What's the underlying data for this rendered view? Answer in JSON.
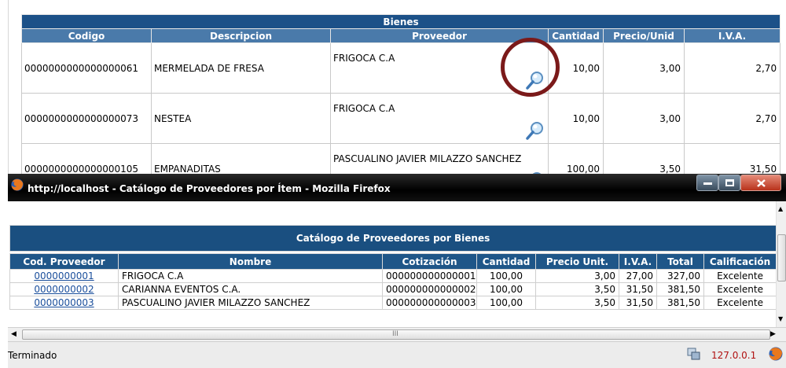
{
  "background_page": {
    "table_title": "Bienes",
    "headers": [
      "Codigo",
      "Descripcion",
      "Proveedor",
      "Cantidad",
      "Precio/Unid",
      "I.V.A."
    ],
    "rows": [
      {
        "codigo": "0000000000000000061",
        "descripcion": "MERMELADA DE FRESA",
        "proveedor": "FRIGOCA C.A",
        "cantidad": "10,00",
        "precio": "3,00",
        "iva": "2,70"
      },
      {
        "codigo": "0000000000000000073",
        "descripcion": "NESTEA",
        "proveedor": "FRIGOCA C.A",
        "cantidad": "10,00",
        "precio": "3,00",
        "iva": "2,70"
      },
      {
        "codigo": "0000000000000000105",
        "descripcion": "EMPANADITAS",
        "proveedor": "PASCUALINO JAVIER MILAZZO SANCHEZ",
        "cantidad": "100,00",
        "precio": "3,50",
        "iva": "31,50"
      }
    ],
    "row_icon": "magnifier-icon",
    "highlight_color": "#7b1a1a"
  },
  "popup": {
    "title": "http://localhost - Catálogo de Proveedores por Ítem - Mozilla Firefox",
    "table_title": "Catálogo de Proveedores por Bienes",
    "headers": [
      "Cod. Proveedor",
      "Nombre",
      "Cotización",
      "Cantidad",
      "Precio Unit.",
      "I.V.A.",
      "Total",
      "Calificación"
    ],
    "rows": [
      {
        "cod": "0000000001",
        "nombre": "FRIGOCA C.A",
        "cotizacion": "000000000000001",
        "cantidad": "100,00",
        "precio": "3,00",
        "iva": "27,00",
        "total": "327,00",
        "calificacion": "Excelente"
      },
      {
        "cod": "0000000002",
        "nombre": "CARIANNA EVENTOS C.A.",
        "cotizacion": "000000000000002",
        "cantidad": "100,00",
        "precio": "3,50",
        "iva": "31,50",
        "total": "381,50",
        "calificacion": "Excelente"
      },
      {
        "cod": "0000000003",
        "nombre": "PASCUALINO JAVIER MILAZZO SANCHEZ",
        "cotizacion": "000000000000003",
        "cantidad": "100,00",
        "precio": "3,50",
        "iva": "31,50",
        "total": "381,50",
        "calificacion": "Excelente"
      }
    ],
    "hscroll_grip": "III",
    "status_text": "Terminado",
    "status_host": "127.0.0.1",
    "icons": [
      "firefox-icon",
      "minimize-icon",
      "maximize-icon",
      "close-icon",
      "network-icon"
    ],
    "colors": {
      "header_blue": "#1f5688",
      "title_blue": "#1a4f80",
      "link": "#1b4f9c",
      "host_red": "#b01010"
    }
  }
}
